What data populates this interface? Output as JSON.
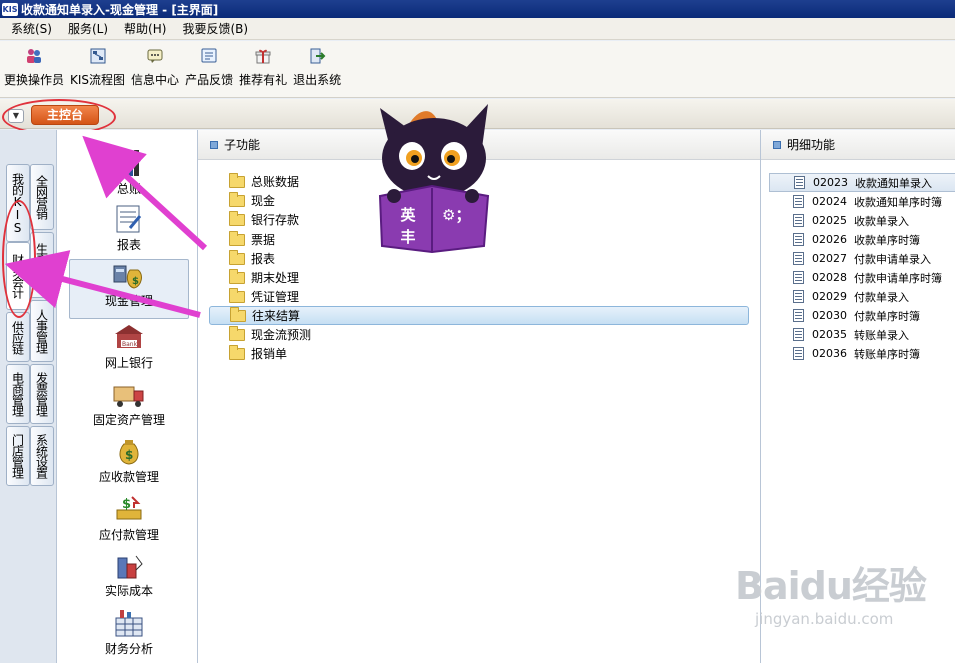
{
  "window": {
    "title": "收款通知单录入-现金管理 - [主界面]",
    "logo": "KIS"
  },
  "menu": [
    {
      "label": "系统(S)"
    },
    {
      "label": "服务(L)"
    },
    {
      "label": "帮助(H)"
    },
    {
      "label": "我要反馈(B)"
    }
  ],
  "toolbar": [
    {
      "label": "更换操作员",
      "icon": "users-icon"
    },
    {
      "label": "KIS流程图",
      "icon": "flowchart-icon"
    },
    {
      "label": "信息中心",
      "icon": "message-icon"
    },
    {
      "label": "产品反馈",
      "icon": "feedback-icon"
    },
    {
      "label": "推荐有礼",
      "icon": "gift-icon"
    },
    {
      "label": "退出系统",
      "icon": "exit-icon"
    }
  ],
  "main_tab": {
    "label": "主控台"
  },
  "left_categories": {
    "col1": [
      {
        "label": "我的KIS"
      },
      {
        "label": "财务会计"
      },
      {
        "label": "供应链"
      },
      {
        "label": "电商管理"
      },
      {
        "label": "门店管理"
      }
    ],
    "col2": [
      {
        "label": "全网营销"
      },
      {
        "label": "生产管理"
      },
      {
        "label": "人事管理"
      },
      {
        "label": "发票管理"
      },
      {
        "label": "系统设置"
      }
    ]
  },
  "modules": [
    {
      "label": "总账"
    },
    {
      "label": "报表"
    },
    {
      "label": "现金管理"
    },
    {
      "label": "网上银行"
    },
    {
      "label": "固定资产管理"
    },
    {
      "label": "应收款管理"
    },
    {
      "label": "应付款管理"
    },
    {
      "label": "实际成本"
    },
    {
      "label": "财务分析"
    }
  ],
  "subfunctions": {
    "header": "子功能",
    "items": [
      {
        "label": "总账数据"
      },
      {
        "label": "现金"
      },
      {
        "label": "银行存款"
      },
      {
        "label": "票据"
      },
      {
        "label": "报表"
      },
      {
        "label": "期末处理"
      },
      {
        "label": "凭证管理"
      },
      {
        "label": "往来结算"
      },
      {
        "label": "现金流预测"
      },
      {
        "label": "报销单"
      }
    ]
  },
  "details": {
    "header": "明细功能",
    "items": [
      {
        "code": "02023",
        "label": "收款通知单录入"
      },
      {
        "code": "02024",
        "label": "收款通知单序时簿"
      },
      {
        "code": "02025",
        "label": "收款单录入"
      },
      {
        "code": "02026",
        "label": "收款单序时簿"
      },
      {
        "code": "02027",
        "label": "付款申请单录入"
      },
      {
        "code": "02028",
        "label": "付款申请单序时簿"
      },
      {
        "code": "02029",
        "label": "付款单录入"
      },
      {
        "code": "02030",
        "label": "付款单序时簿"
      },
      {
        "code": "02035",
        "label": "转账单录入"
      },
      {
        "code": "02036",
        "label": "转账单序时簿"
      }
    ]
  },
  "mascot": {
    "text_left": "英丰",
    "text_right": "⚙；"
  },
  "watermark": {
    "main": "Baidu经验",
    "sub": "jingyan.baidu.com"
  },
  "colors": {
    "accent": "#e0323c",
    "arrow": "#e040d0",
    "tab": "#d45416",
    "title": "#0a2a78"
  }
}
